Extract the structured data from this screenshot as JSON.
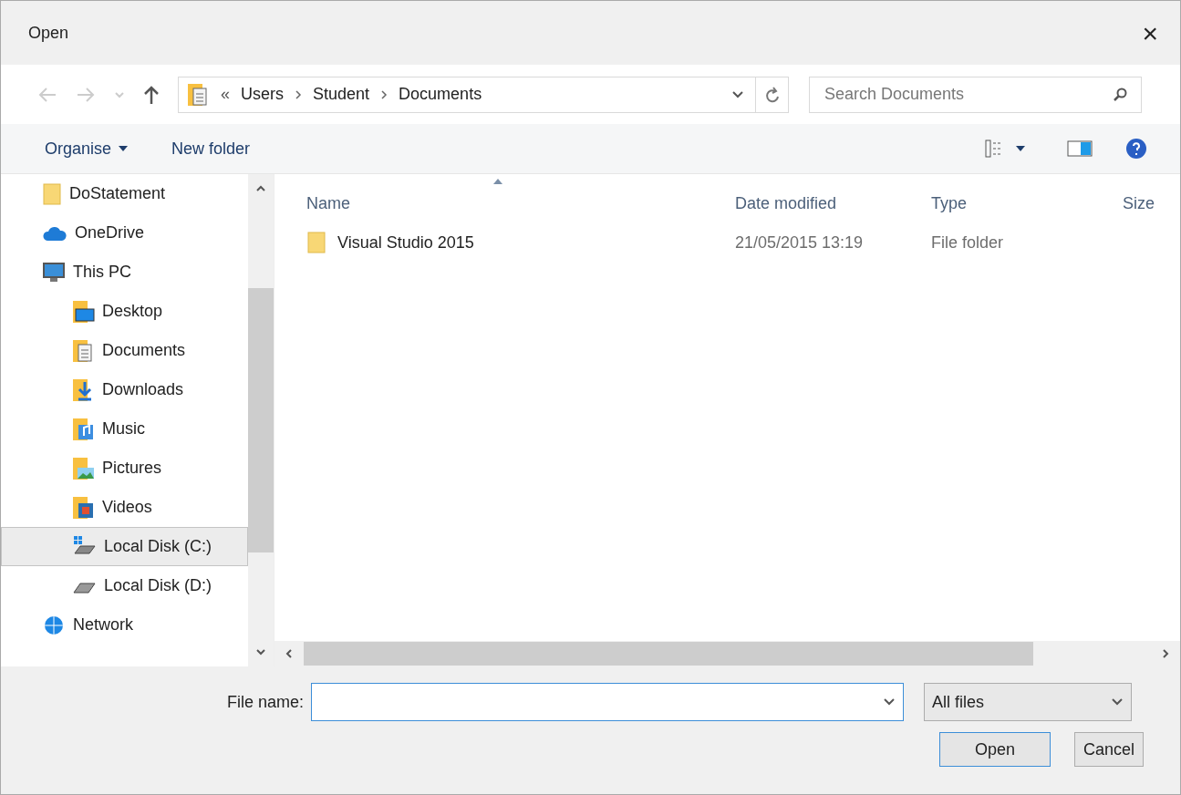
{
  "window": {
    "title": "Open",
    "close": "×"
  },
  "address_bar": {
    "overflow": "«",
    "crumbs": [
      "Users",
      "Student",
      "Documents"
    ]
  },
  "search": {
    "placeholder": "Search Documents"
  },
  "toolbar": {
    "organise": "Organise",
    "new_folder": "New folder"
  },
  "sidebar": {
    "items": [
      {
        "kind": "hidden",
        "children": [
          {
            "label": "DoStatement",
            "kind": "folder",
            "selected": false
          }
        ]
      },
      {
        "label": "OneDrive",
        "kind": "cloud",
        "selected": false
      },
      {
        "label": "This PC",
        "kind": "pc",
        "selected": false,
        "children": [
          {
            "label": "Desktop",
            "kind": "desktop",
            "selected": false
          },
          {
            "label": "Documents",
            "kind": "documents",
            "selected": false
          },
          {
            "label": "Downloads",
            "kind": "downloads",
            "selected": false
          },
          {
            "label": "Music",
            "kind": "music",
            "selected": false
          },
          {
            "label": "Pictures",
            "kind": "pictures",
            "selected": false
          },
          {
            "label": "Videos",
            "kind": "videos",
            "selected": false
          },
          {
            "label": "Local Disk (C:)",
            "kind": "system-drive",
            "selected": true
          },
          {
            "label": "Local Disk (D:)",
            "kind": "drive",
            "selected": false
          }
        ]
      },
      {
        "label": "Network",
        "kind": "network",
        "selected": false
      }
    ]
  },
  "table": {
    "columns": [
      {
        "label": "Name",
        "sorted": true
      },
      {
        "label": "Date modified",
        "sorted": false
      },
      {
        "label": "Type",
        "sorted": false
      },
      {
        "label": "Size",
        "sorted": false
      }
    ],
    "rows": [
      {
        "name": "Visual Studio 2015",
        "date_modified": "21/05/2015 13:19",
        "type": "File folder"
      }
    ]
  },
  "file_name": {
    "label": "File name:"
  },
  "file_type": {
    "value": "All files"
  },
  "buttons": [
    "Open",
    "Cancel"
  ]
}
